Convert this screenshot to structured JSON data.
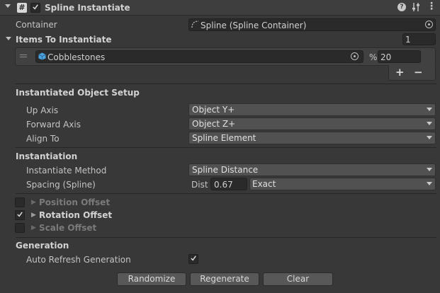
{
  "header": {
    "title": "Spline Instantiate",
    "enabled": true
  },
  "container": {
    "label": "Container",
    "value": "Spline (Spline Container)"
  },
  "items": {
    "label": "Items To Instantiate",
    "count": "1",
    "entries": [
      {
        "name": "Cobblestones",
        "percent_symbol": "%",
        "percent": "20"
      }
    ],
    "add_label": "+",
    "remove_label": "−"
  },
  "setup": {
    "section_label": "Instantiated Object Setup",
    "up_axis": {
      "label": "Up Axis",
      "value": "Object Y+"
    },
    "forward_axis": {
      "label": "Forward Axis",
      "value": "Object Z+"
    },
    "align_to": {
      "label": "Align To",
      "value": "Spline Element"
    }
  },
  "instantiation": {
    "section_label": "Instantiation",
    "method": {
      "label": "Instantiate Method",
      "value": "Spline Distance"
    },
    "spacing": {
      "label": "Spacing (Spline)",
      "dist_label": "Dist",
      "dist_value": "0.67",
      "mode": "Exact"
    }
  },
  "offsets": [
    {
      "label": "Position Offset",
      "checked": false,
      "enabled": false
    },
    {
      "label": "Rotation Offset",
      "checked": true,
      "enabled": true
    },
    {
      "label": "Scale Offset",
      "checked": false,
      "enabled": false
    }
  ],
  "generation": {
    "section_label": "Generation",
    "auto_refresh": {
      "label": "Auto Refresh Generation",
      "checked": true
    }
  },
  "buttons": {
    "randomize": "Randomize",
    "regenerate": "Regenerate",
    "clear": "Clear"
  }
}
